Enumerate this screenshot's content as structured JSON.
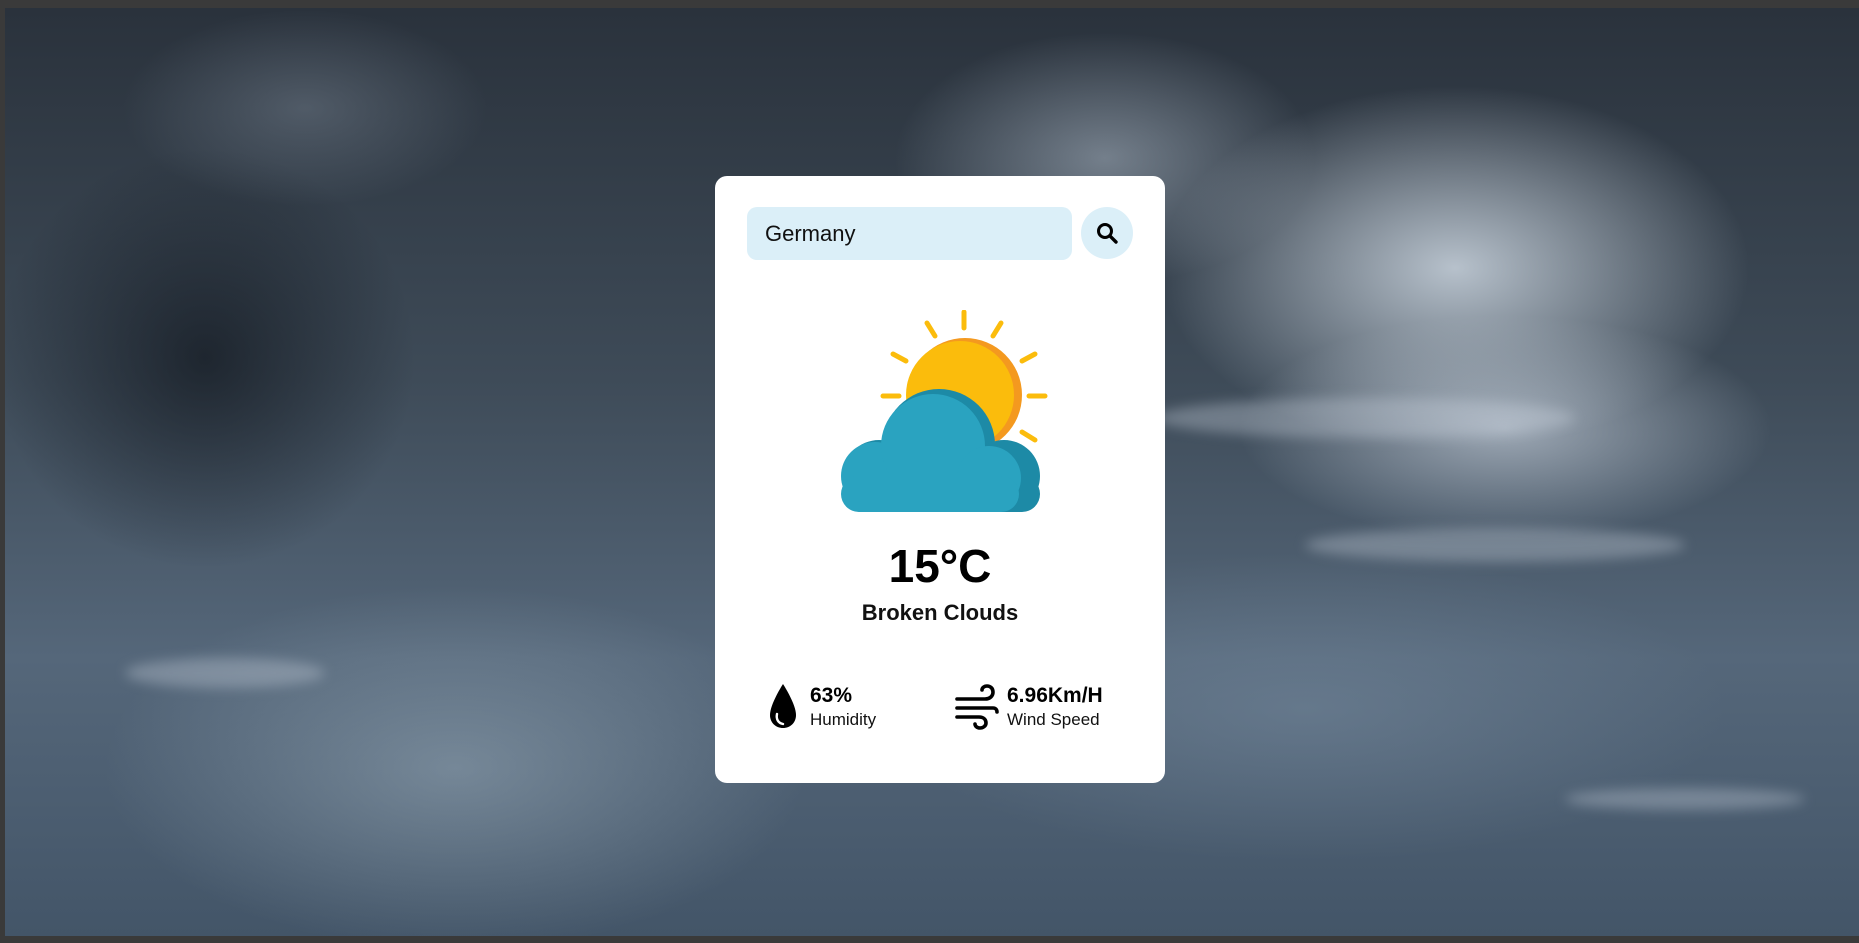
{
  "search": {
    "value": "Germany",
    "placeholder": "Enter city name"
  },
  "weather": {
    "icon": "sun-behind-cloud-icon",
    "temperature": "15°C",
    "description": "Broken Clouds"
  },
  "details": {
    "humidity": {
      "icon": "water-drop-icon",
      "value": "63%",
      "label": "Humidity"
    },
    "wind": {
      "icon": "wind-icon",
      "value": "6.96Km/H",
      "label": "Wind Speed"
    }
  },
  "colors": {
    "card_background": "#ffffff",
    "input_background": "#dbeff8",
    "sun": "#fbbc0c",
    "sun_shade": "#f4991f",
    "cloud": "#2aa3c0",
    "cloud_shade": "#1d8aa6"
  }
}
